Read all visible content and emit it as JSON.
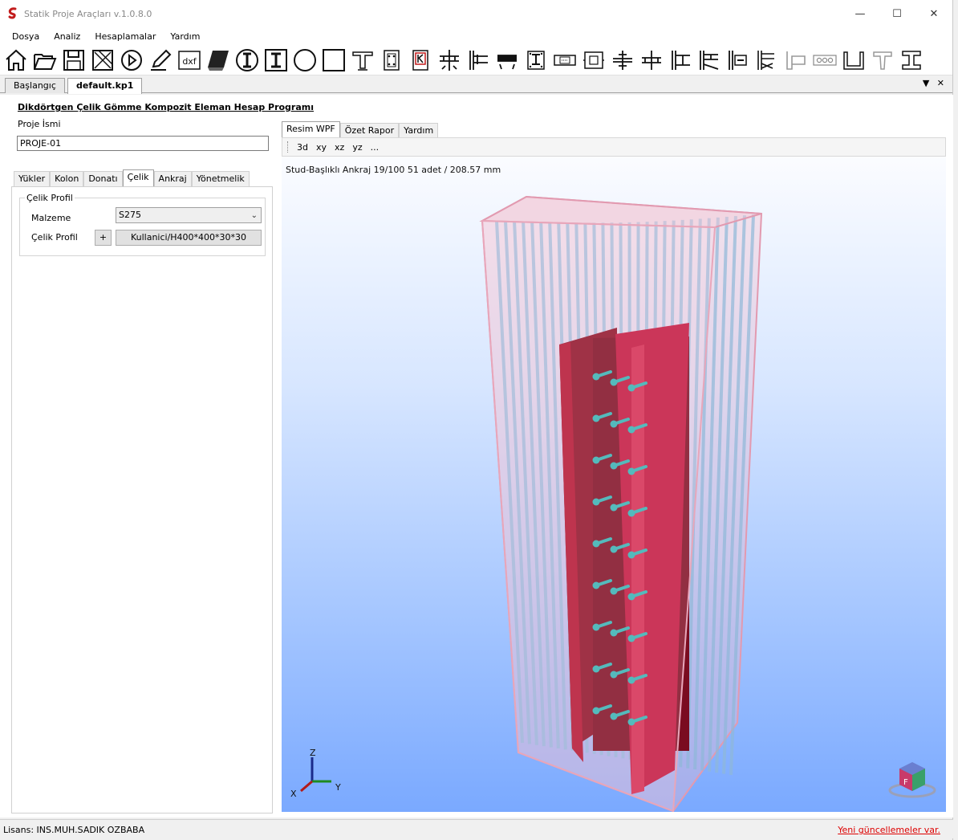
{
  "window": {
    "title": "Statik Proje Araçları v.1.0.8.0"
  },
  "menu": [
    "Dosya",
    "Analiz",
    "Hesaplamalar",
    "Yardım"
  ],
  "toolbar_icons": [
    "home-icon",
    "open-folder-icon",
    "save-icon",
    "delete-icon",
    "play-icon",
    "edit-icon",
    "dxf-icon",
    "solid-icon",
    "i-section-round-icon",
    "i-section-square-icon",
    "circle-section-icon",
    "square-section-icon",
    "t-beam-icon",
    "column-plan-icon",
    "k-column-icon",
    "beam-column-icon",
    "shear-tab-icon",
    "end-plate-icon",
    "base-plate-icon",
    "splice-icon",
    "box-splice-icon",
    "flange-joint-icon",
    "cross-joint-icon",
    "wide-joint-icon",
    "double-joint-icon",
    "moment-joint-icon",
    "braced-joint-icon",
    "angle-joint-icon",
    "bolt-row-icon",
    "u-channel-icon",
    "tee-icon",
    "i-beam-icon"
  ],
  "toolbar_labels": {
    "dxf": "dxf"
  },
  "doc_tabs": [
    {
      "label": "Başlangıç"
    },
    {
      "label": "default.kp1"
    }
  ],
  "program_title": "Dikdörtgen Çelik Gömme Kompozit Eleman Hesap Programı",
  "project": {
    "label": "Proje İsmi",
    "value": "PROJE-01"
  },
  "left_tabs": [
    "Yükler",
    "Kolon",
    "Donatı",
    "Çelik",
    "Ankraj",
    "Yönetmelik"
  ],
  "celik": {
    "group": "Çelik Profil",
    "material_label": "Malzeme",
    "material_value": "S275",
    "profile_label": "Çelik Profil",
    "plus": "+",
    "profile_value": "Kullanici/H400*400*30*30"
  },
  "right_tabs": [
    "Resim WPF",
    "Özet Rapor",
    "Yardım"
  ],
  "view_buttons": [
    "3d",
    "xy",
    "xz",
    "yz",
    "..."
  ],
  "viewport_info": "Stud-Başlıklı Ankraj 19/100  51 adet / 208.57 mm",
  "axes": {
    "z": "Z",
    "x": "X",
    "y": "Y"
  },
  "status": {
    "license": "Lisans: INS.MUH.SADIK OZBABA",
    "update": "Yeni güncellemeler var."
  },
  "colors": {
    "steel": "#c0143c",
    "stud": "#2fb5b5",
    "concrete": "#f2b8c8"
  }
}
